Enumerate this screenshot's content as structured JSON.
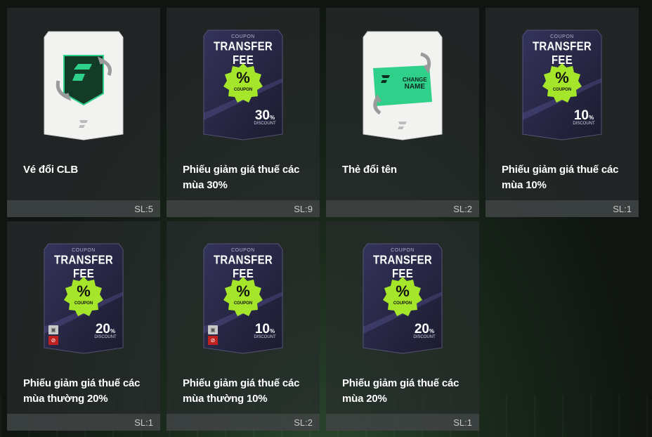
{
  "items": [
    {
      "name": "Vé đổi CLB",
      "qty": "SL:5",
      "type": "club-ticket"
    },
    {
      "name": "Phiếu giảm giá thuế các mùa 30%",
      "qty": "SL:9",
      "type": "coupon",
      "coupon_label": "COUPON",
      "coupon_title": "TRANSFER FEE",
      "badge_symbol": "%",
      "badge_text": "COUPON",
      "discount": "30",
      "discount_unit": "%",
      "discount_label": "DISCOUNT",
      "restricted": false
    },
    {
      "name": "Thẻ đổi tên",
      "qty": "SL:2",
      "type": "name-change",
      "card_text_1": "CHANGE",
      "card_text_2": "NAME"
    },
    {
      "name": "Phiếu giảm giá thuế các mùa 10%",
      "qty": "SL:1",
      "type": "coupon",
      "coupon_label": "COUPON",
      "coupon_title": "TRANSFER FEE",
      "badge_symbol": "%",
      "badge_text": "COUPON",
      "discount": "10",
      "discount_unit": "%",
      "discount_label": "DISCOUNT",
      "restricted": false
    },
    {
      "name": "Phiếu giảm giá thuế các mùa thường 20%",
      "qty": "SL:1",
      "type": "coupon",
      "coupon_label": "COUPON",
      "coupon_title": "TRANSFER FEE",
      "badge_symbol": "%",
      "badge_text": "COUPON",
      "discount": "20",
      "discount_unit": "%",
      "discount_label": "DISCOUNT",
      "restricted": true
    },
    {
      "name": "Phiếu giảm giá thuế các mùa thường 10%",
      "qty": "SL:2",
      "type": "coupon",
      "coupon_label": "COUPON",
      "coupon_title": "TRANSFER FEE",
      "badge_symbol": "%",
      "badge_text": "COUPON",
      "discount": "10",
      "discount_unit": "%",
      "discount_label": "DISCOUNT",
      "restricted": true
    },
    {
      "name": "Phiếu giảm giá thuế các mùa 20%",
      "qty": "SL:1",
      "type": "coupon",
      "coupon_label": "COUPON",
      "coupon_title": "TRANSFER FEE",
      "badge_symbol": "%",
      "badge_text": "COUPON",
      "discount": "20",
      "discount_unit": "%",
      "discount_label": "DISCOUNT",
      "restricted": false
    }
  ],
  "colors": {
    "badge": "#a6e62a",
    "card_dark": "#2b2a4a",
    "accent_green": "#2fd08a",
    "restricted": "#c02020"
  }
}
